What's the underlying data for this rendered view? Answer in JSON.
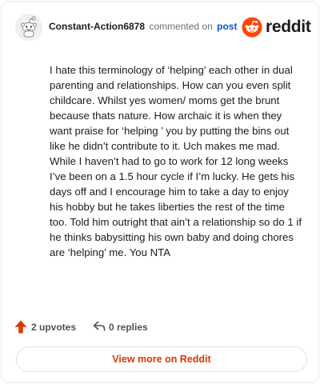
{
  "comment": {
    "username": "Constant-Action6878",
    "action_text": "commented on",
    "post_link": "post",
    "brand": "reddit",
    "body": "I hate this terminology of ‘helping’ each other in dual parenting and relationships. How can you even split childcare. Whilst yes women/ moms get the brunt because thats nature. How archaic it is when they want praise for ‘helping ’ you by putting the bins out like he didn’t contribute to it. Uch makes me mad. While I haven’t had to go to work for 12 long weeks I’ve been on a 1.5 hour cycle if I’m lucky. He gets his days off and I encourage him to take a day to enjoy his hobby but he takes liberties the rest of the time too. Told him outright that ain’t a relationship so do 1 if he thinks babysitting his own baby and doing chores are ‘helping’ me. You NTA"
  },
  "actions": {
    "upvotes": "2 upvotes",
    "replies": "0 replies"
  },
  "footer": {
    "view_more": "View more on Reddit"
  },
  "colors": {
    "accent": "#d93a00",
    "link": "#0a52d6",
    "upvote_icon": "#d93a00",
    "brand_orange": "#ff4500"
  },
  "icons": {
    "avatar": "snoo-avatar-icon",
    "brand": "reddit-logo-icon",
    "upvote": "upvote-arrow-icon",
    "reply": "reply-arrow-icon"
  }
}
